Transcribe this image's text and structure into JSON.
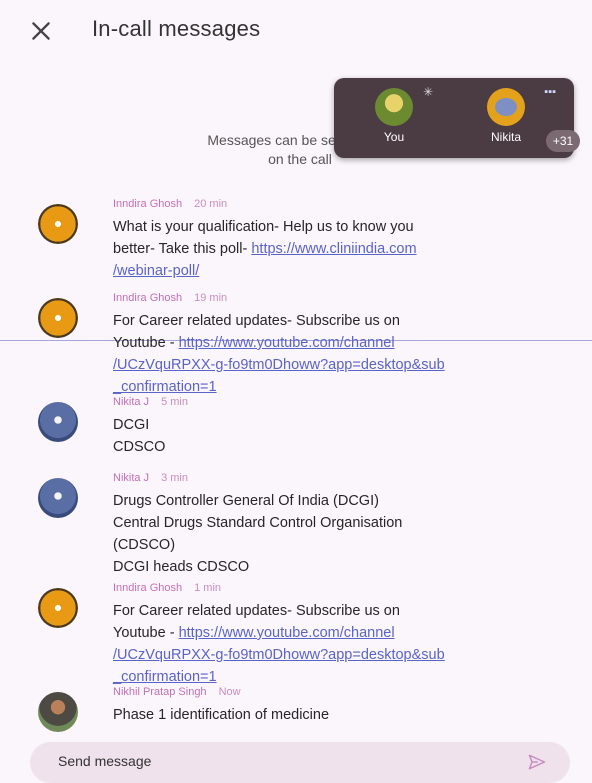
{
  "header": {
    "title": "In-call messages",
    "close_icon": "close-icon"
  },
  "notice": {
    "line1": "Messages can be seen only d",
    "line2": "on the call"
  },
  "pip": {
    "tiles": [
      {
        "name": "You",
        "icon": "mic-off-icon"
      },
      {
        "name": "Nikita",
        "icon": "audio-level-icon"
      }
    ],
    "more_count": "+31"
  },
  "messages": [
    {
      "author": "Inndira Ghosh",
      "time": "20 min",
      "avatar": "orange",
      "lines": [
        {
          "text": "What is your qualification- Help us to know you"
        },
        {
          "text": "better-  Take this poll- ",
          "link": "https://www.cliniindia.com"
        },
        {
          "link": "/webinar-poll/"
        }
      ]
    },
    {
      "author": "Inndira Ghosh",
      "time": "19 min",
      "avatar": "orange",
      "lines": [
        {
          "text": "For Career related updates- Subscribe us on"
        },
        {
          "text": "Youtube - ",
          "link": "https://www.youtube.com/channel"
        },
        {
          "link": "/UCzVquRPXX-g-fo9tm0Dhoww?app=desktop&sub"
        },
        {
          "link": "_confirmation=1"
        }
      ]
    },
    {
      "author": "Nikita J",
      "time": "5 min",
      "avatar": "blue",
      "lines": [
        {
          "text": "DCGI"
        },
        {
          "text": "CDSCO"
        }
      ]
    },
    {
      "author": "Nikita J",
      "time": "3 min",
      "avatar": "blue",
      "lines": [
        {
          "text": "Drugs Controller General Of India (DCGI)"
        },
        {
          "text": "Central Drugs Standard Control Organisation"
        },
        {
          "text": "(CDSCO)"
        },
        {
          "text": "DCGI heads CDSCO"
        }
      ]
    },
    {
      "author": "Inndira Ghosh",
      "time": "1 min",
      "avatar": "orange",
      "lines": [
        {
          "text": "For Career related updates- Subscribe us on"
        },
        {
          "text": "Youtube - ",
          "link": "https://www.youtube.com/channel"
        },
        {
          "link": "/UCzVquRPXX-g-fo9tm0Dhoww?app=desktop&sub"
        },
        {
          "link": "_confirmation=1"
        }
      ]
    },
    {
      "author": "Nikhil Pratap Singh",
      "time": "Now",
      "avatar": "photo",
      "lines": [
        {
          "text": "Phase 1 identification of medicine"
        }
      ]
    }
  ],
  "composer": {
    "placeholder": "Send message",
    "send_icon": "send-icon"
  }
}
